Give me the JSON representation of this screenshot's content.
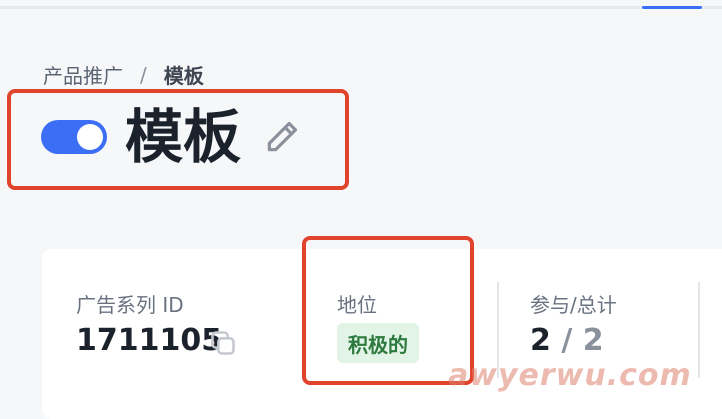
{
  "breadcrumb": {
    "parent": "产品推广",
    "separator": "/",
    "current": "模板"
  },
  "header": {
    "title": "模板",
    "toggle_on": true
  },
  "stats": {
    "campaign_id": {
      "label": "广告系列 ID",
      "value": "1711105"
    },
    "status": {
      "label": "地位",
      "badge": "积极的"
    },
    "participation": {
      "label": "参与/总计",
      "value": "2",
      "separator": "/",
      "total": "2"
    }
  },
  "watermark": "awyerwu.com",
  "colors": {
    "accent": "#3b6ef5",
    "highlight": "#e0442c",
    "badge_bg": "#e2f4e6",
    "badge_text": "#2d7a3e"
  },
  "icons": {
    "edit": "pencil-icon",
    "copy": "copy-icon"
  }
}
